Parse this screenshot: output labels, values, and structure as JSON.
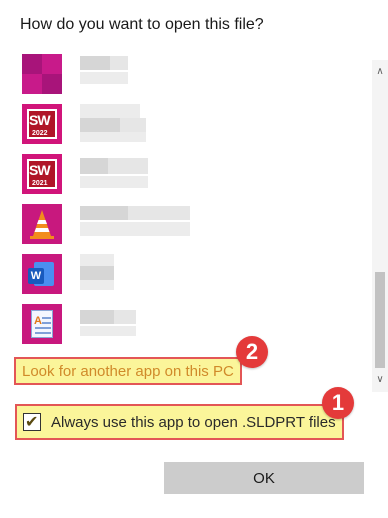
{
  "dialog": {
    "title": "How do you want to open this file?"
  },
  "apps": [
    {
      "icon": "magenta-tile-app-icon",
      "name_blurred": true
    },
    {
      "icon": "solidworks-2022-icon",
      "icon_text": "SW",
      "icon_year": "2022",
      "name_blurred": true
    },
    {
      "icon": "solidworks-2021-icon",
      "icon_text": "SW",
      "icon_year": "2021",
      "name_blurred": true
    },
    {
      "icon": "vlc-cone-icon",
      "name_blurred": true
    },
    {
      "icon": "word-icon",
      "icon_text": "W",
      "name_blurred": true
    },
    {
      "icon": "wordpad-icon",
      "icon_text": "A",
      "name_blurred": true
    }
  ],
  "other_app_link": "Look for another app on this PC",
  "always_use": {
    "label": "Always use this app to open .SLDPRT files",
    "checked": true
  },
  "ok_label": "OK",
  "badges": [
    "2",
    "1"
  ],
  "colors": {
    "highlight_fill": "#fbf59a",
    "highlight_border": "#e35656",
    "badge": "#e43a3a",
    "tile_background": "#c8187e",
    "ok_button": "#cccccc"
  }
}
